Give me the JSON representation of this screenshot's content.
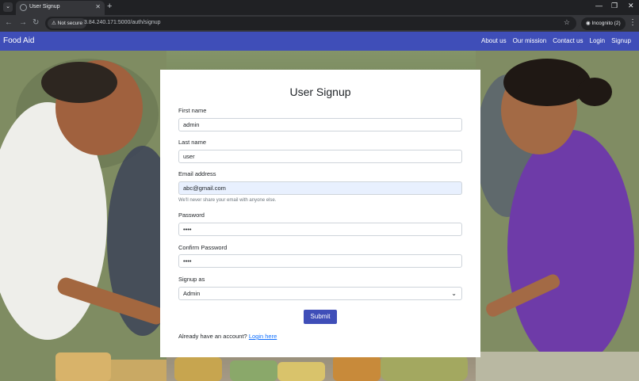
{
  "browser": {
    "tab_title": "User Signup",
    "address_chip": "Not secure",
    "url": "3.84.240.171:5000/auth/signup",
    "profile_chip": "Incognito (2)"
  },
  "navbar": {
    "brand": "Food Aid",
    "links": [
      "About us",
      "Our mission",
      "Contact us",
      "Login",
      "Signup"
    ]
  },
  "form": {
    "title": "User Signup",
    "first_name": {
      "label": "First name",
      "value": "admin"
    },
    "last_name": {
      "label": "Last name",
      "value": "user"
    },
    "email": {
      "label": "Email address",
      "value": "abc@gmail.com",
      "help": "We'll never share your email with anyone else."
    },
    "password": {
      "label": "Password",
      "value": "••••"
    },
    "confirm_password": {
      "label": "Confirm Password",
      "value": "••••"
    },
    "signup_as": {
      "label": "Signup as",
      "value": "Admin"
    },
    "submit_label": "Submit",
    "login_prompt": "Already have an account?",
    "login_link": "Login here"
  },
  "colors": {
    "navbar": "#3f4eb8",
    "button": "#3f4eb8",
    "link": "#0d6efd",
    "autofill": "#e8f0fe"
  },
  "icons": {
    "tab": "globe-icon",
    "back": "back-arrow-icon",
    "forward": "forward-arrow-icon",
    "reload": "reload-icon",
    "warning": "warning-icon",
    "star": "star-icon",
    "incognito": "incognito-icon",
    "menu": "kebab-menu-icon",
    "select": "chevron-down-icon"
  }
}
